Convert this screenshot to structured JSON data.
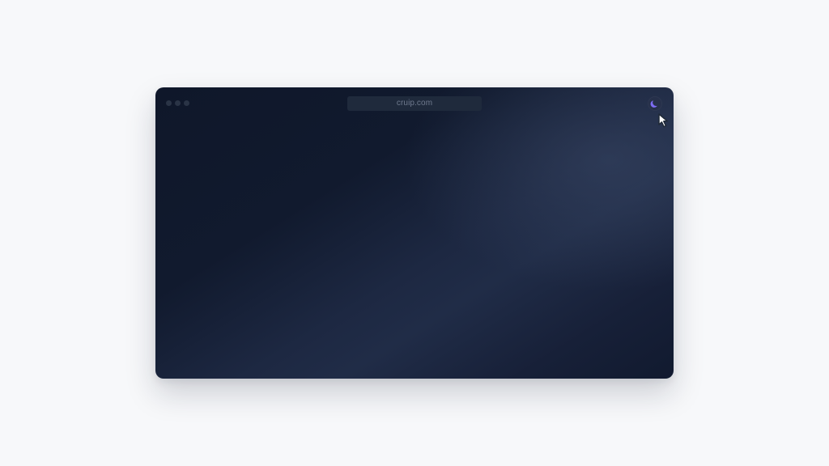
{
  "browser": {
    "address": "cruip.com",
    "theme_toggle_icon": "moon-icon",
    "cursor_icon": "mouse-pointer-icon",
    "accent_color": "#7c6cf2"
  }
}
